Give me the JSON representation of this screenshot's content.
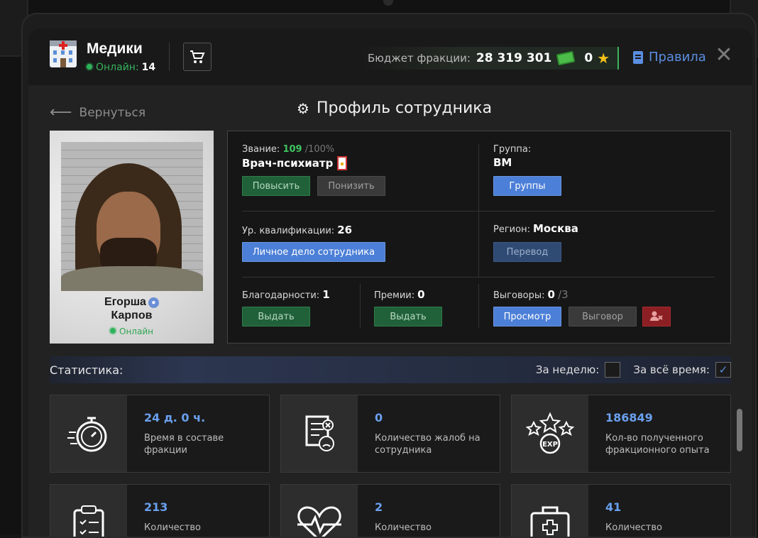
{
  "header": {
    "faction_name": "Медики",
    "online_label": "Онлайн:",
    "online_count": "14",
    "budget_label": "Бюджет фракции:",
    "budget_value": "28 319 301",
    "stars_value": "0",
    "rules_label": "Правила",
    "close_glyph": "✕"
  },
  "nav": {
    "back_label": "Вернуться",
    "page_title": "Профиль сотрудника"
  },
  "employee": {
    "first_name": "Егорша",
    "last_name": "Карпов",
    "status": "Онлайн"
  },
  "info": {
    "rank_label": "Звание:",
    "rank_value": "109",
    "rank_max": "/100%",
    "rank_name": "Врач-психиатр",
    "promote_btn": "Повысить",
    "demote_btn": "Понизить",
    "group_label": "Группа:",
    "group_value": "ВМ",
    "groups_btn": "Группы",
    "qual_label": "Ур. квалификации:",
    "qual_value": "26",
    "personal_file_btn": "Личное дело сотрудника",
    "region_label": "Регион:",
    "region_value": "Москва",
    "transfer_btn": "Перевод",
    "thanks_label": "Благодарности:",
    "thanks_value": "1",
    "thanks_btn": "Выдать",
    "bonus_label": "Премии:",
    "bonus_value": "0",
    "bonus_btn": "Выдать",
    "reprimand_label": "Выговоры:",
    "reprimand_value": "0",
    "reprimand_max": "/3",
    "view_btn": "Просмотр",
    "reprimand_btn": "Выговор"
  },
  "stats": {
    "title": "Статистика:",
    "week_label": "За неделю:",
    "all_time_label": "За всё время:",
    "week_checked": false,
    "all_time_checked": true,
    "tiles": [
      {
        "value": "24 д. 0 ч.",
        "label": "Время в составе фракции",
        "icon": "stopwatch-icon"
      },
      {
        "value": "0",
        "label": "Количество жалоб на сотрудника",
        "icon": "complaint-doc-icon"
      },
      {
        "value": "186849",
        "label": "Кол-во полученного фракционного опыта",
        "icon": "exp-stars-icon"
      },
      {
        "value": "213",
        "label": "Количество",
        "icon": "clipboard-icon"
      },
      {
        "value": "2",
        "label": "Количество",
        "icon": "heartbeat-icon"
      },
      {
        "value": "41",
        "label": "Количество",
        "icon": "medkit-icon"
      }
    ]
  },
  "colors": {
    "accent_blue": "#4c7fd7",
    "online_green": "#2fb35a",
    "danger_red": "#8b1f24"
  }
}
